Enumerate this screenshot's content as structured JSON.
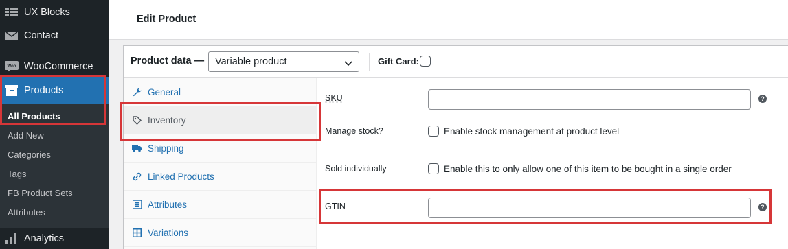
{
  "sidebar": {
    "items": [
      {
        "label": "UX Blocks",
        "icon": "grid-blocks-icon"
      },
      {
        "label": "Contact",
        "icon": "envelope-icon"
      },
      {
        "label": "WooCommerce",
        "icon": "woo-icon"
      },
      {
        "label": "Products",
        "icon": "archive-box-icon"
      },
      {
        "label": "Analytics",
        "icon": "bar-chart-icon"
      }
    ],
    "woo_badge": "Woo",
    "submenu": [
      "All Products",
      "Add New",
      "Categories",
      "Tags",
      "FB Product Sets",
      "Attributes"
    ]
  },
  "header": {
    "title": "Edit Product"
  },
  "product_data": {
    "title": "Product data —",
    "type_value": "Variable product",
    "gift_card_label": "Gift Card:",
    "gift_card_checked": false
  },
  "tabs": [
    {
      "label": "General",
      "icon": "wrench-icon"
    },
    {
      "label": "Inventory",
      "icon": "tag-icon"
    },
    {
      "label": "Shipping",
      "icon": "truck-icon"
    },
    {
      "label": "Linked Products",
      "icon": "link-icon"
    },
    {
      "label": "Attributes",
      "icon": "list-icon"
    },
    {
      "label": "Variations",
      "icon": "grid-icon"
    }
  ],
  "fields": {
    "sku": {
      "label": "SKU",
      "value": "",
      "help": "?"
    },
    "manage_stock": {
      "label": "Manage stock?",
      "checkbox_label": "Enable stock management at product level"
    },
    "sold_individually": {
      "label": "Sold individually",
      "checkbox_label": "Enable this to only allow one of this item to be bought in a single order"
    },
    "gtin": {
      "label": "GTIN",
      "value": "",
      "help": "?"
    }
  },
  "colors": {
    "sidebar_bg": "#1d2327",
    "accent": "#2271b1",
    "highlight": "#d63638"
  }
}
